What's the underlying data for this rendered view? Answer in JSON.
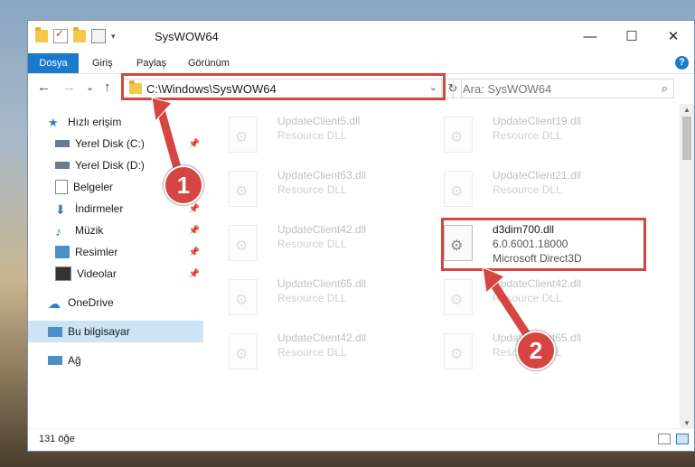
{
  "window": {
    "title": "SysWOW64",
    "minimize": "—",
    "maximize": "☐",
    "close": "✕"
  },
  "ribbon": {
    "tabs": [
      {
        "label": "Dosya"
      },
      {
        "label": "Giriş"
      },
      {
        "label": "Paylaş"
      },
      {
        "label": "Görünüm"
      }
    ],
    "help": "?"
  },
  "nav": {
    "back": "←",
    "forward": "→",
    "recent": "⌄",
    "up": "↑",
    "path": "C:\\Windows\\SysWOW64",
    "refresh": "↻",
    "search_placeholder": "Ara: SysWOW64"
  },
  "sidebar": {
    "items": [
      {
        "label": "Hızlı erişim"
      },
      {
        "label": "Yerel Disk (C:)"
      },
      {
        "label": "Yerel Disk (D:)"
      },
      {
        "label": "Belgeler"
      },
      {
        "label": "İndirmeler"
      },
      {
        "label": "Müzik"
      },
      {
        "label": "Resimler"
      },
      {
        "label": "Videolar"
      },
      {
        "label": "OneDrive"
      },
      {
        "label": "Bu bilgisayar"
      },
      {
        "label": "Ağ"
      }
    ]
  },
  "files": [
    {
      "name": "UpdateClient5.dll",
      "desc": "Resource DLL"
    },
    {
      "name": "UpdateClient19.dll",
      "desc": "Resource DLL"
    },
    {
      "name": "UpdateClient63.dll",
      "desc": "Resource DLL"
    },
    {
      "name": "UpdateClient21.dll",
      "desc": "Resource DLL"
    },
    {
      "name": "UpdateClient42.dll",
      "desc": "Resource DLL"
    },
    {
      "name": "d3dim700.dll",
      "version": "6.0.6001.18000",
      "desc": "Microsoft Direct3D"
    },
    {
      "name": "UpdateClient65.dll",
      "desc": "Resource DLL"
    },
    {
      "name": "UpdateClient42.dll",
      "desc": "Resource DLL"
    },
    {
      "name": "UpdateClient42.dll",
      "desc": "Resource DLL"
    },
    {
      "name": "UpdateClient65.dll",
      "desc": "Resource DLL"
    }
  ],
  "status": {
    "count": "131 öğe"
  },
  "annotations": {
    "step1": "1",
    "step2": "2"
  },
  "colors": {
    "accent": "#1979ca",
    "highlight": "#d64541"
  }
}
